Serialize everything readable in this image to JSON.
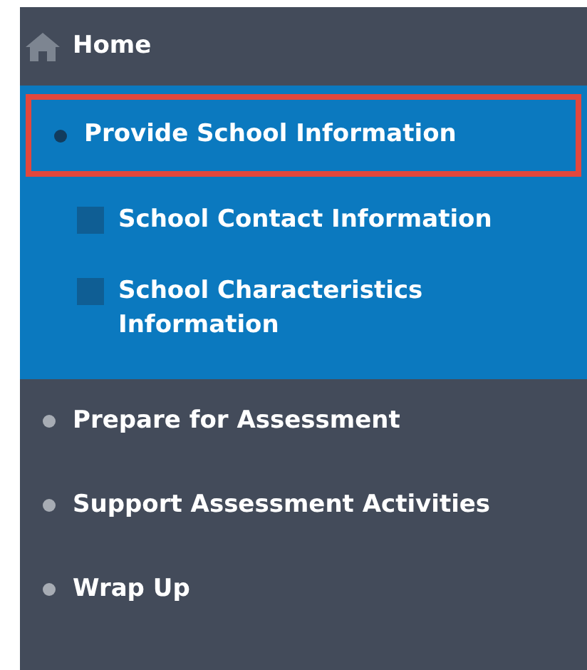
{
  "home": {
    "label": "Home"
  },
  "items": [
    {
      "label": "Provide School Information",
      "selected": true,
      "outlined": true,
      "children": [
        {
          "label": "School Contact Information"
        },
        {
          "label": "School Characteristics Information"
        }
      ]
    },
    {
      "label": "Prepare for Assessment",
      "selected": false,
      "outlined": false
    },
    {
      "label": "Support Assessment Activities",
      "selected": false,
      "outlined": false
    },
    {
      "label": "Wrap Up",
      "selected": false,
      "outlined": false
    }
  ]
}
